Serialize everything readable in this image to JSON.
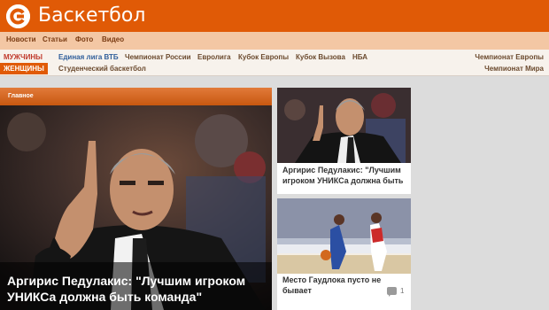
{
  "header": {
    "title": "Баскетбол",
    "logo_icon": "logo-c-icon",
    "color": "#e05a06"
  },
  "subnav": {
    "items": [
      "Новости",
      "Статьи",
      "Фото",
      "Видео"
    ]
  },
  "categories": {
    "tabs": [
      "МУЖЧИНЫ",
      "ЖЕНЩИНЫ"
    ],
    "links_row1": [
      "Единая лига ВТБ",
      "Чемпионат России",
      "Евролига",
      "Кубок Европы",
      "Кубок Вызова",
      "НБА"
    ],
    "links_row2": [
      "Студенческий баскетбол"
    ],
    "right_links": [
      "Чемпионат Европы",
      "Чемпионат Мира"
    ]
  },
  "main": {
    "section_label": "Главное",
    "headline": "Аргирис Педулакис: \"Лучшим игроком УНИКСа должна быть команда\""
  },
  "side": [
    {
      "title": "Аргирис Педулакис: \"Лучшим игроком УНИКСа должна быть"
    },
    {
      "title": "Место Гаудлока пусто не бывает",
      "comment_icon": "comment-icon",
      "comments": "1"
    }
  ]
}
